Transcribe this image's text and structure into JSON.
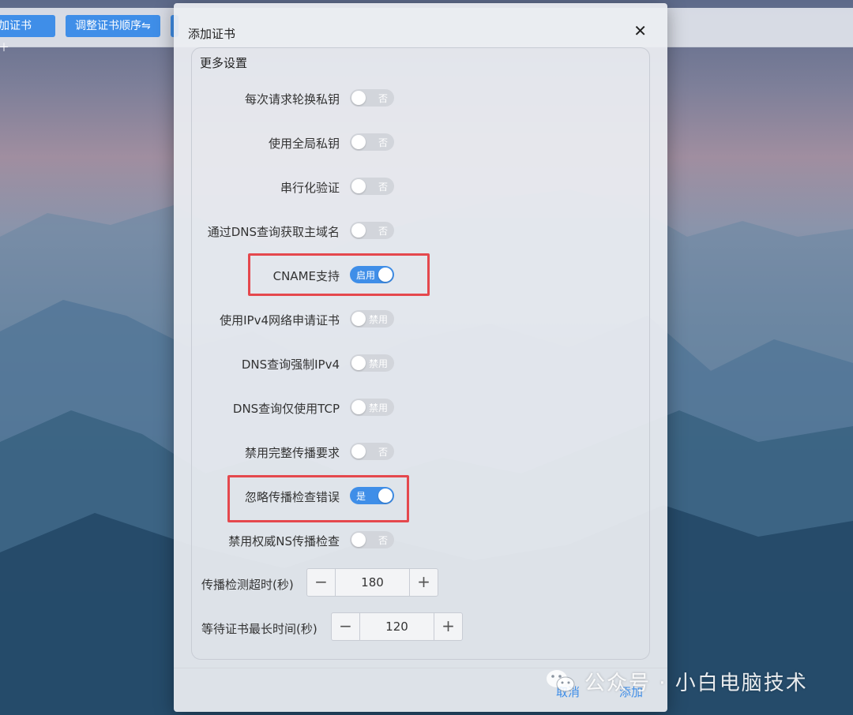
{
  "toolbar": {
    "add_cert": "加证书 ＋",
    "reorder": "调整证书顺序⇋"
  },
  "dialog": {
    "title": "添加证书",
    "close": "✕",
    "section_title": "更多设置",
    "toggles": [
      {
        "label": "每次请求轮换私钥",
        "state": "否",
        "on": false
      },
      {
        "label": "使用全局私钥",
        "state": "否",
        "on": false
      },
      {
        "label": "串行化验证",
        "state": "否",
        "on": false
      },
      {
        "label": "通过DNS查询获取主域名",
        "state": "否",
        "on": false
      },
      {
        "label": "CNAME支持",
        "state": "启用",
        "on": true
      },
      {
        "label": "使用IPv4网络申请证书",
        "state": "禁用",
        "on": false
      },
      {
        "label": "DNS查询强制IPv4",
        "state": "禁用",
        "on": false
      },
      {
        "label": "DNS查询仅使用TCP",
        "state": "禁用",
        "on": false
      },
      {
        "label": "禁用完整传播要求",
        "state": "否",
        "on": false
      },
      {
        "label": "忽略传播检查错误",
        "state": "是",
        "on": true
      },
      {
        "label": "禁用权威NS传播检查",
        "state": "否",
        "on": false
      }
    ],
    "propagation_timeout": {
      "label": "传播检测超时(秒)",
      "value": "180",
      "minus": "−",
      "plus": "+"
    },
    "max_wait": {
      "label": "等待证书最长时间(秒)",
      "value": "120",
      "minus": "−",
      "plus": "+"
    },
    "cancel": "取消",
    "add": "添加"
  },
  "watermark": {
    "text": "公众号 · 小白电脑技术",
    "icon": "wechat-icon"
  },
  "colors": {
    "accent": "#3f8ee8",
    "highlight": "#e5484d"
  }
}
